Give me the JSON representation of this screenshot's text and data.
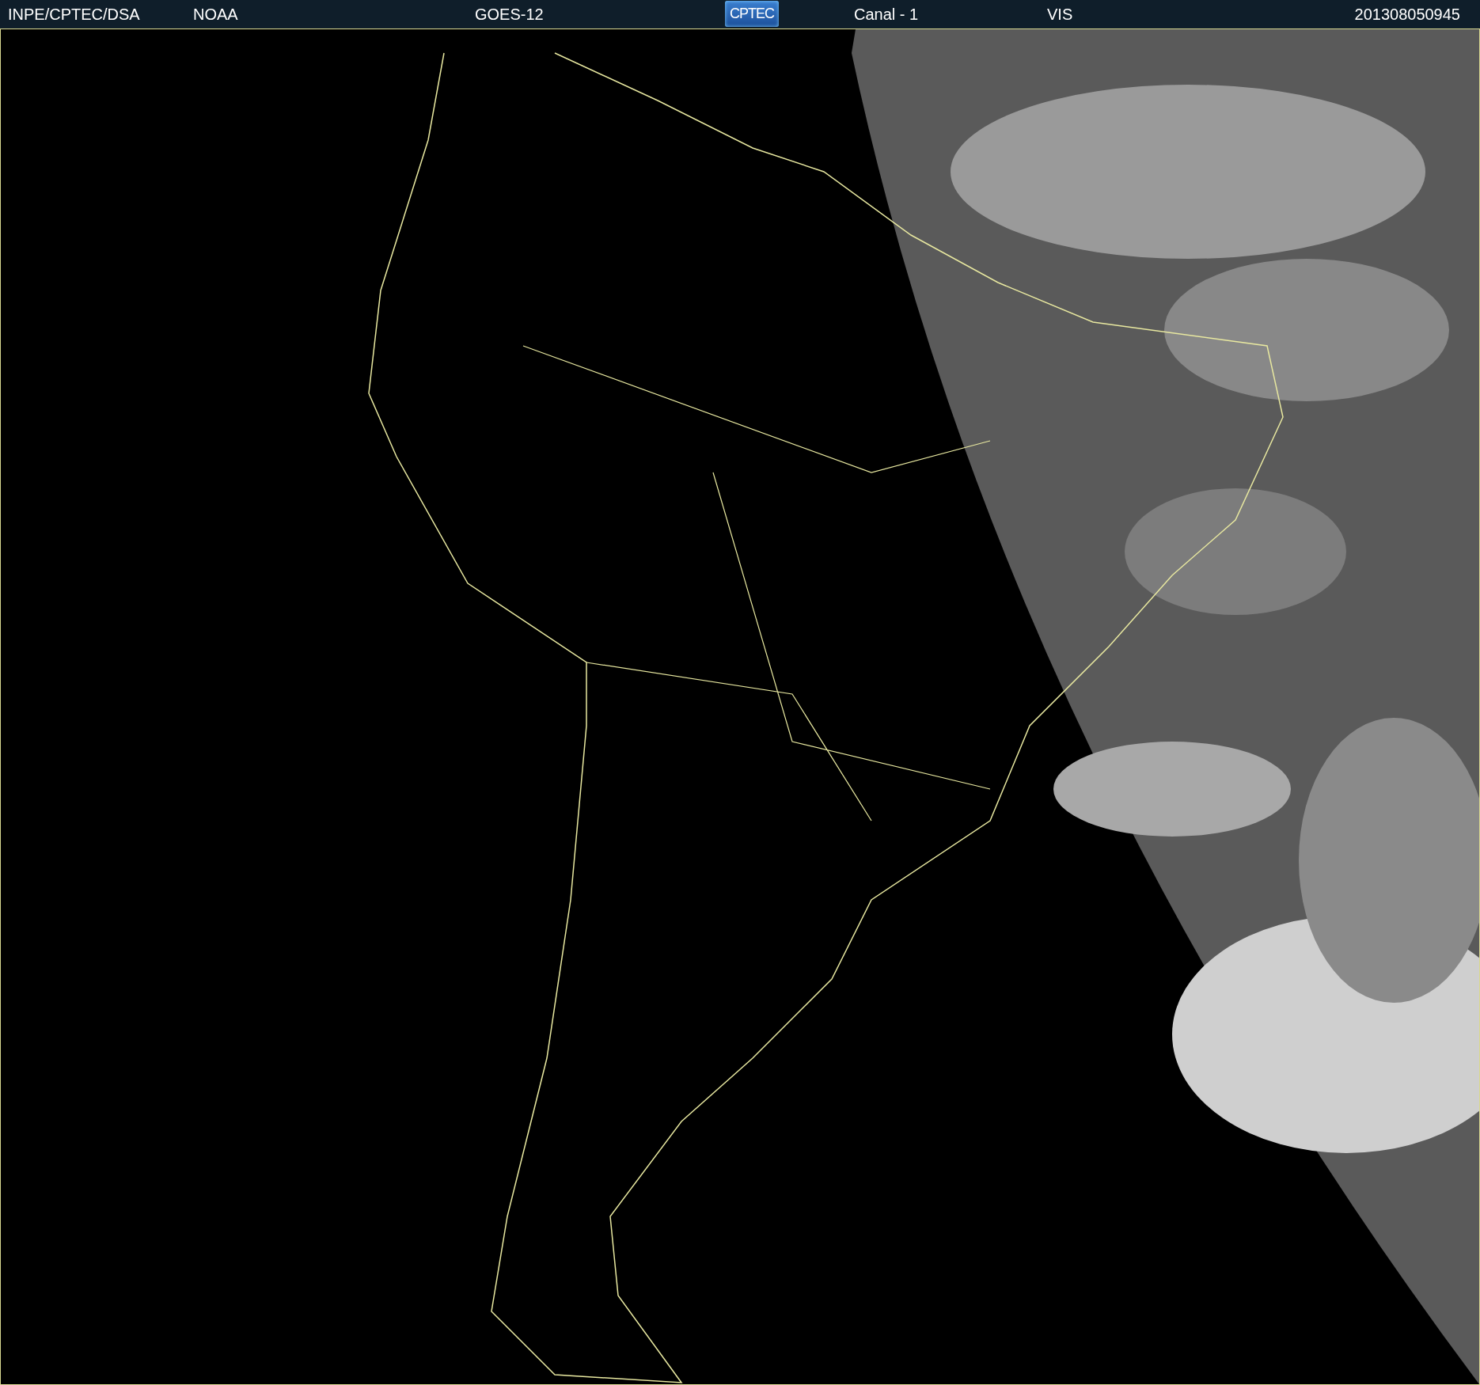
{
  "header": {
    "items": [
      {
        "kind": "text",
        "text": "INPE/CPTEC/DSA"
      },
      {
        "kind": "text",
        "text": "NOAA"
      },
      {
        "kind": "text",
        "text": "GOES-12"
      },
      {
        "kind": "logo",
        "text": "CPTEC"
      },
      {
        "kind": "text",
        "text": "Canal - 1"
      },
      {
        "kind": "text",
        "text": "VIS"
      },
      {
        "kind": "text",
        "text": "201308050945"
      }
    ]
  }
}
